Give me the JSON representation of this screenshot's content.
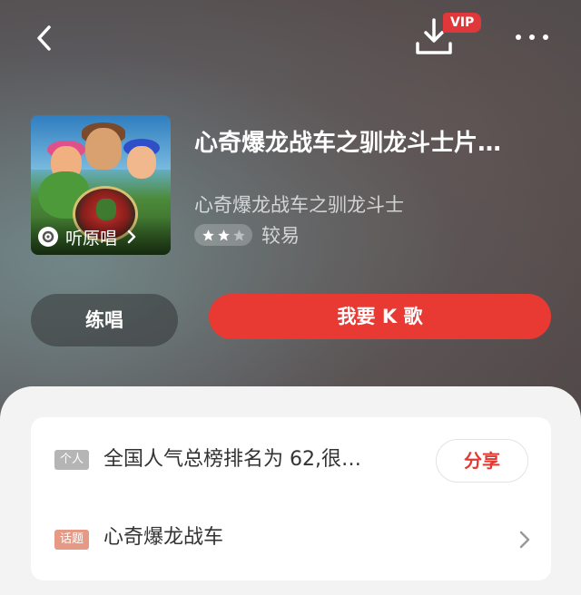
{
  "header": {
    "back_icon": "chevron-left-icon",
    "download_icon": "download-icon",
    "vip_badge": "VIP",
    "more_icon": "more-horizontal-icon"
  },
  "song": {
    "title": "心奇爆龙战车之驯龙斗士片…",
    "subtitle": "心奇爆龙战车之驯龙斗士",
    "listen_original": "听原唱",
    "difficulty_stars": 2,
    "difficulty_max": 3,
    "difficulty_label": "较易"
  },
  "actions": {
    "practice": "练唱",
    "sing": "我要 K 歌"
  },
  "info_card": {
    "personal_tag": "个人",
    "ranking_text": "全国人气总榜排名为 62,很…",
    "share_label": "分享",
    "topic_tag": "话题",
    "topic_text": "心奇爆龙战车"
  },
  "colors": {
    "accent_red": "#e83a33",
    "vip_red": "#e0383a",
    "personal_tag_gray": "#b5b5b5",
    "topic_tag_orange": "#e69a86"
  }
}
